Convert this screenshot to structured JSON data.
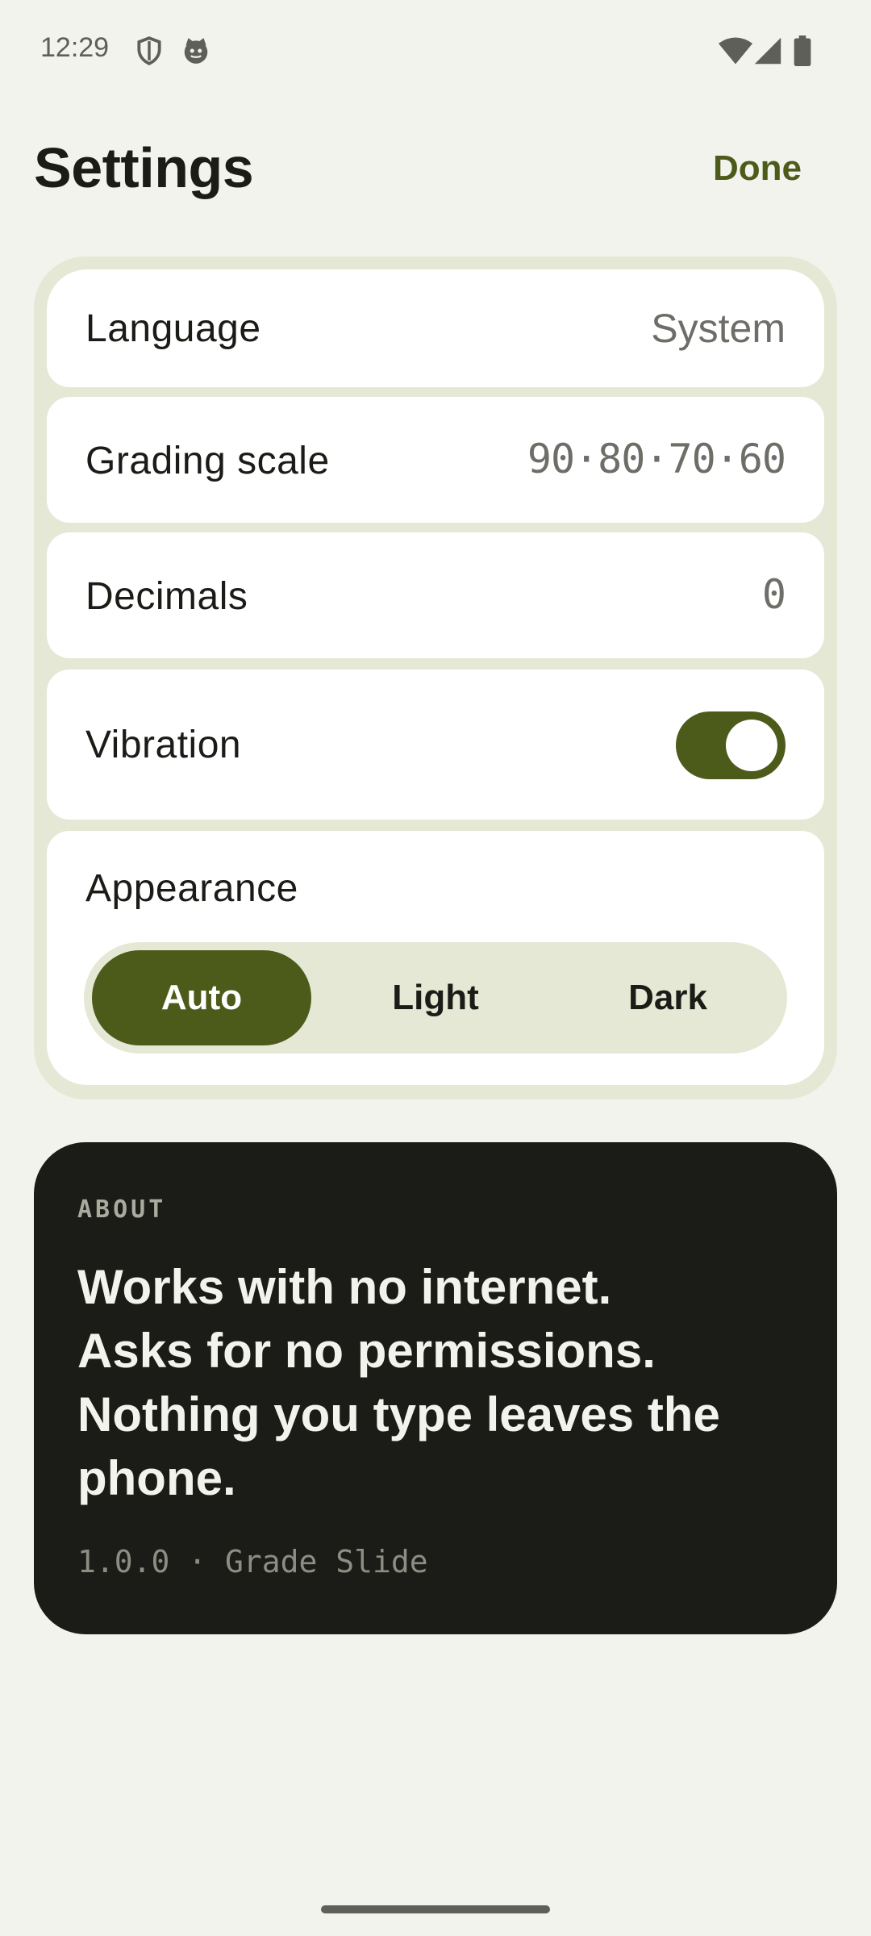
{
  "status_bar": {
    "time": "12:29",
    "icons": [
      "shield-icon",
      "cat-face-icon",
      "wifi-icon",
      "cellular-signal-icon",
      "battery-icon"
    ]
  },
  "header": {
    "title": "Settings",
    "done_label": "Done"
  },
  "settings": {
    "language": {
      "label": "Language",
      "value": "System"
    },
    "grading_scale": {
      "label": "Grading scale",
      "value": "90·80·70·60"
    },
    "decimals": {
      "label": "Decimals",
      "value": "0"
    },
    "vibration": {
      "label": "Vibration",
      "enabled": true
    },
    "appearance": {
      "label": "Appearance",
      "options": [
        "Auto",
        "Light",
        "Dark"
      ],
      "selected": "Auto"
    }
  },
  "about": {
    "eyebrow": "ABOUT",
    "lines": [
      "Works with no internet.",
      "Asks for no permissions.",
      "Nothing you type leaves the",
      "phone."
    ],
    "version": "1.0.0 · Grade Slide"
  },
  "colors": {
    "background": "#f3f3ee",
    "accent": "#4d5b1a",
    "group_background": "#e5e8d4",
    "card_dark": "#1b1c17"
  }
}
